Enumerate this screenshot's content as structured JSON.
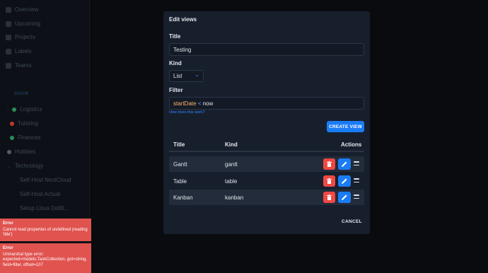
{
  "sidebar": {
    "nav": [
      {
        "label": "Overview",
        "icon": "home-icon"
      },
      {
        "label": "Upcoming",
        "icon": "calendar-icon"
      },
      {
        "label": "Projects",
        "icon": "layers-icon"
      },
      {
        "label": "Labels",
        "icon": "tag-icon"
      },
      {
        "label": "Teams",
        "icon": "users-icon"
      }
    ],
    "section_title": "SHOW",
    "projects": [
      {
        "label": "Logistics",
        "color": "#2e8b57"
      },
      {
        "label": "Tutoring",
        "color": "#c0392b"
      },
      {
        "label": "Finances",
        "color": "#2e8b57"
      },
      {
        "label": "Hobbies",
        "color": "#555c66"
      },
      {
        "label": "Technology",
        "color": ""
      },
      {
        "label": "Self-Host NextCloud",
        "color": ""
      },
      {
        "label": "Self-Host Actual",
        "color": ""
      },
      {
        "label": "Setup Linux Dotfil...",
        "color": ""
      }
    ]
  },
  "modal": {
    "title": "Edit views",
    "title_label": "Title",
    "title_value": "Testing",
    "kind_label": "Kind",
    "kind_value": "List",
    "filter_label": "Filter",
    "filter_key": "startDate",
    "filter_op": "<",
    "filter_value": "now",
    "help_link": "How does this work?",
    "create_button": "CREATE VIEW",
    "table": {
      "headers": {
        "title": "Title",
        "kind": "Kind",
        "actions": "Actions"
      },
      "rows": [
        {
          "title": "Gantt",
          "kind": "gantt"
        },
        {
          "title": "Table",
          "kind": "table"
        },
        {
          "title": "Kanban",
          "kind": "kanban"
        }
      ]
    },
    "cancel_button": "CANCEL"
  },
  "errors": [
    {
      "title": "Error",
      "message": "Cannot read properties of undefined (reading 'title')"
    },
    {
      "title": "Error",
      "message": "Unmarshal type error: expected=models.TaskCollection, got=string, field=filter, offset=107"
    }
  ],
  "colors": {
    "accent": "#1a7cf5",
    "danger": "#f14844",
    "toast": "#e0534f",
    "modal_bg": "#171f2d"
  }
}
